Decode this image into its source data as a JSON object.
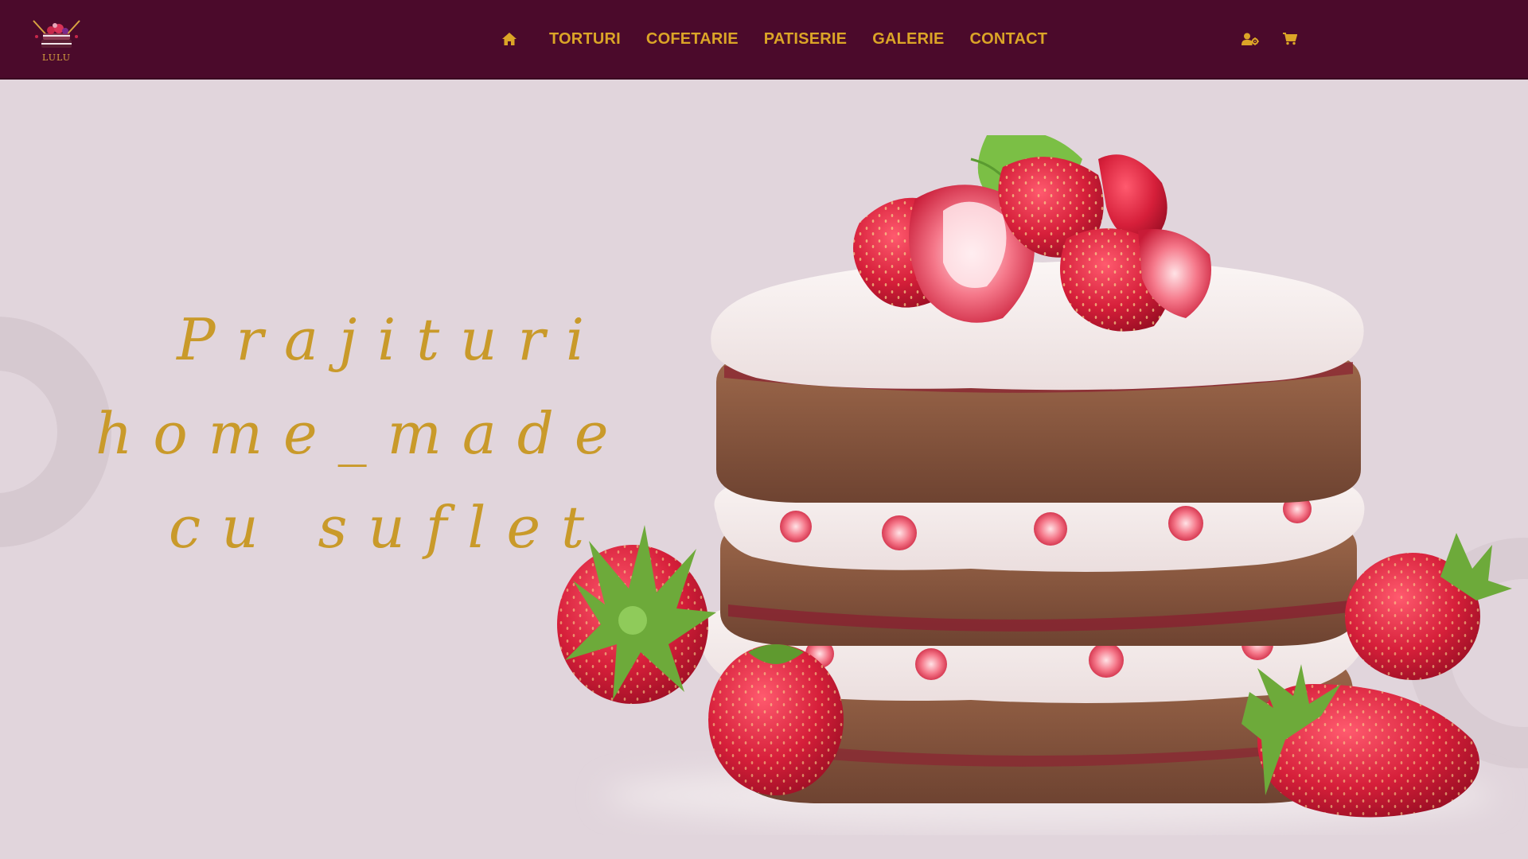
{
  "brand": {
    "logo_text": "LULU"
  },
  "nav": {
    "home_icon": "home-icon",
    "items": [
      {
        "label": "TORTURI"
      },
      {
        "label": "COFETARIE"
      },
      {
        "label": "PATISERIE"
      },
      {
        "label": "GALERIE"
      },
      {
        "label": "CONTACT"
      }
    ],
    "right_icons": [
      "user-settings-icon",
      "cart-icon"
    ]
  },
  "hero": {
    "lines": [
      "Prajituri",
      "home_made",
      "cu suflet"
    ],
    "image": "layered-strawberry-cake"
  },
  "colors": {
    "navbar_bg": "#4b0a2b",
    "accent_gold": "#dba527",
    "hero_text": "#c99a2a",
    "page_bg": "#e1d5dc"
  }
}
